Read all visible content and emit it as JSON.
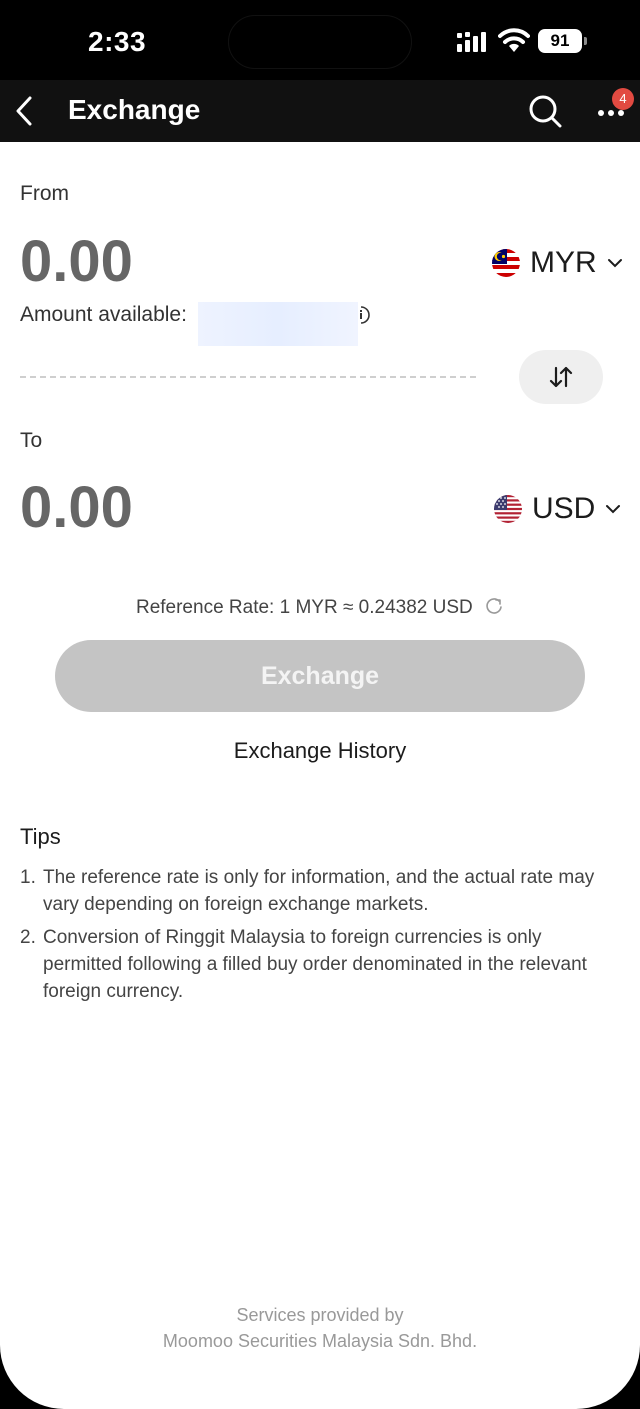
{
  "status_bar": {
    "time": "2:33",
    "battery": "91"
  },
  "nav": {
    "title": "Exchange",
    "notification_count": "4"
  },
  "from": {
    "label": "From",
    "amount": "0.00",
    "currency": "MYR",
    "available_label": "Amount available:"
  },
  "to": {
    "label": "To",
    "amount": "0.00",
    "currency": "USD"
  },
  "rate": {
    "text": "Reference Rate: 1 MYR ≈ 0.24382 USD"
  },
  "exchange_button": "Exchange",
  "history_link": "Exchange History",
  "tips": {
    "title": "Tips",
    "items": [
      {
        "num": "1.",
        "text": "The reference rate is only for information, and the actual rate may vary depending on foreign exchange markets."
      },
      {
        "num": "2.",
        "text": "Conversion of Ringgit Malaysia to foreign currencies is only permitted following a filled buy order denominated in the relevant foreign currency."
      }
    ]
  },
  "footer": {
    "line1": "Services provided by",
    "line2": "Moomoo Securities Malaysia Sdn. Bhd."
  },
  "colors": {
    "badge": "#e24a41",
    "button_disabled": "#c4c4c4",
    "nav_bg": "#111111"
  }
}
